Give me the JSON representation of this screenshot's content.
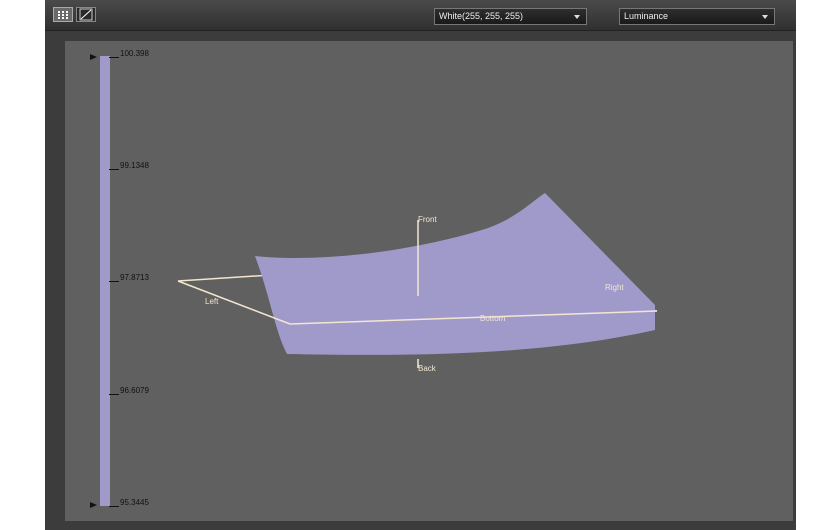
{
  "toolbar": {
    "view_buttons": [
      "grid-view",
      "curve-view"
    ],
    "color_dropdown": "White(255, 255, 255)",
    "mode_dropdown": "Luminance"
  },
  "colorbar": {
    "color": "#9f9ac9",
    "ticks": [
      "100.398",
      "99.1348",
      "97.8713",
      "96.6079",
      "95.3445"
    ]
  },
  "surface": {
    "color": "#9f9ac9",
    "frame_color": "#f3e6cf",
    "labels": {
      "front": "Front",
      "back": "Back",
      "left": "Left",
      "right": "Right",
      "bottom": "Bottom"
    }
  }
}
